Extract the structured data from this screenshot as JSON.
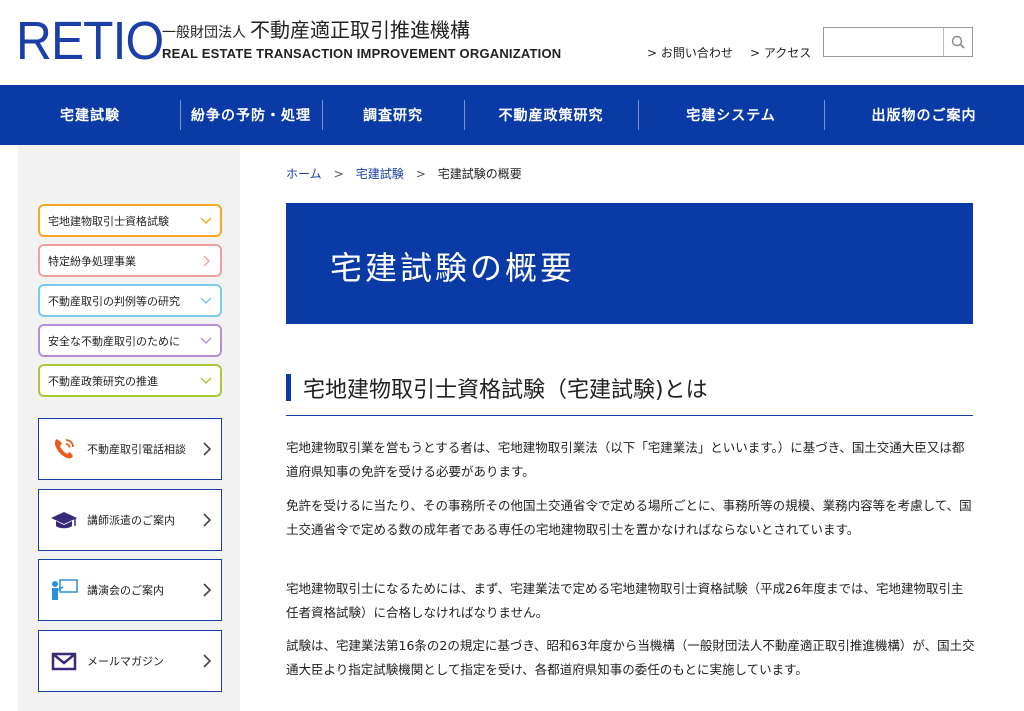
{
  "header": {
    "logo": "RETIO",
    "org_prefix": "一般財団法人",
    "org_name": "不動産適正取引推進機構",
    "org_name_en": "REAL ESTATE TRANSACTION IMPROVEMENT ORGANIZATION",
    "contact_link": "> お問い合わせ",
    "access_link": "> アクセス",
    "search_placeholder": ""
  },
  "nav": {
    "items": [
      {
        "label": "宅建試験"
      },
      {
        "label": "紛争の予防・処理"
      },
      {
        "label": "調査研究"
      },
      {
        "label": "不動産政策研究"
      },
      {
        "label": "宅建システム"
      },
      {
        "label": "出版物のご案内"
      }
    ]
  },
  "sidebar": {
    "categories": [
      {
        "label": "宅地建物取引士資格試験",
        "color": "#f5a623",
        "chevron": "down"
      },
      {
        "label": "特定紛争処理事業",
        "color": "#f0a0a0",
        "chevron": "right"
      },
      {
        "label": "不動産取引の判例等の研究",
        "color": "#7cc8e8",
        "chevron": "down"
      },
      {
        "label": "安全な不動産取引のために",
        "color": "#b48fd6",
        "chevron": "down"
      },
      {
        "label": "不動産政策研究の推進",
        "color": "#a8c838",
        "chevron": "down"
      }
    ],
    "services": [
      {
        "label": "不動産取引電話相談",
        "icon": "phone-icon"
      },
      {
        "label": "講師派遣のご案内",
        "icon": "graduation-cap-icon"
      },
      {
        "label": "講演会のご案内",
        "icon": "lecture-icon"
      },
      {
        "label": "メールマガジン",
        "icon": "mail-icon"
      }
    ]
  },
  "breadcrumb": {
    "home": "ホーム",
    "parent": "宅建試験",
    "current": "宅建試験の概要",
    "sep": ">"
  },
  "page": {
    "title": "宅建試験の概要",
    "section_title": "宅地建物取引士資格試験（宅建試験)とは",
    "paragraphs": [
      "宅地建物取引業を営もうとする者は、宅地建物取引業法（以下「宅建業法」といいます。）に基づき、国土交通大臣又は都道府県知事の免許を受ける必要があります。",
      "免許を受けるに当たり、その事務所その他国土交通省令で定める場所ごとに、事務所等の規模、業務内容等を考慮して、国土交通省令で定める数の成年者である専任の宅地建物取引士を置かなければならないとされています。",
      "宅地建物取引士になるためには、まず、宅建業法で定める宅地建物取引士資格試験（平成26年度までは、宅地建物取引主任者資格試験）に合格しなければなりません。",
      "試験は、宅建業法第16条の2の規定に基づき、昭和63年度から当機構（一般財団法人不動産適正取引推進機構）が、国土交通大臣より指定試験機関として指定を受け、各都道府県知事の委任のもとに実施しています。"
    ]
  },
  "colors": {
    "brand_blue": "#0a3aa6",
    "logo_blue": "#1a3fa8",
    "sidebar_bg": "#f2f2f2"
  }
}
